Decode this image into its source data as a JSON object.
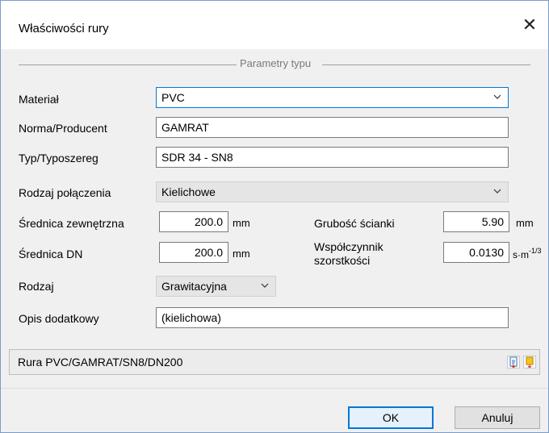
{
  "window": {
    "title": "Właściwości rury",
    "close_glyph": "✕"
  },
  "group": {
    "title": "Parametry typu"
  },
  "fields": {
    "material": {
      "label": "Materiał",
      "value": "PVC"
    },
    "norm": {
      "label": "Norma/Producent",
      "value": "GAMRAT"
    },
    "type": {
      "label": "Typ/Typoszereg",
      "value": "SDR 34 - SN8"
    },
    "connection": {
      "label": "Rodzaj połączenia",
      "value": "Kielichowe"
    },
    "outer_diameter": {
      "label": "Średnica zewnętrzna",
      "value": "200.0",
      "unit": "mm"
    },
    "wall_thickness": {
      "label": "Grubość ścianki",
      "value": "5.90",
      "unit": "mm"
    },
    "dn_diameter": {
      "label": "Średnica DN",
      "value": "200.0",
      "unit": "mm"
    },
    "roughness": {
      "label_line1": "Współczynnik",
      "label_line2": "szorstkości",
      "value": "0.0130",
      "unit_base": "s·m",
      "unit_exp": "-1/3"
    },
    "kind": {
      "label": "Rodzaj",
      "value": "Grawitacyjna"
    },
    "description": {
      "label": "Opis dodatkowy",
      "value": "(kielichowa)"
    }
  },
  "summary": {
    "value": "Rura PVC/GAMRAT/SN8/DN200",
    "icons": [
      "document-icon",
      "tag-icon"
    ]
  },
  "buttons": {
    "ok": "OK",
    "cancel": "Anuluj"
  },
  "colors": {
    "accent": "#0078d7",
    "window_bg": "#f0f0f0"
  }
}
